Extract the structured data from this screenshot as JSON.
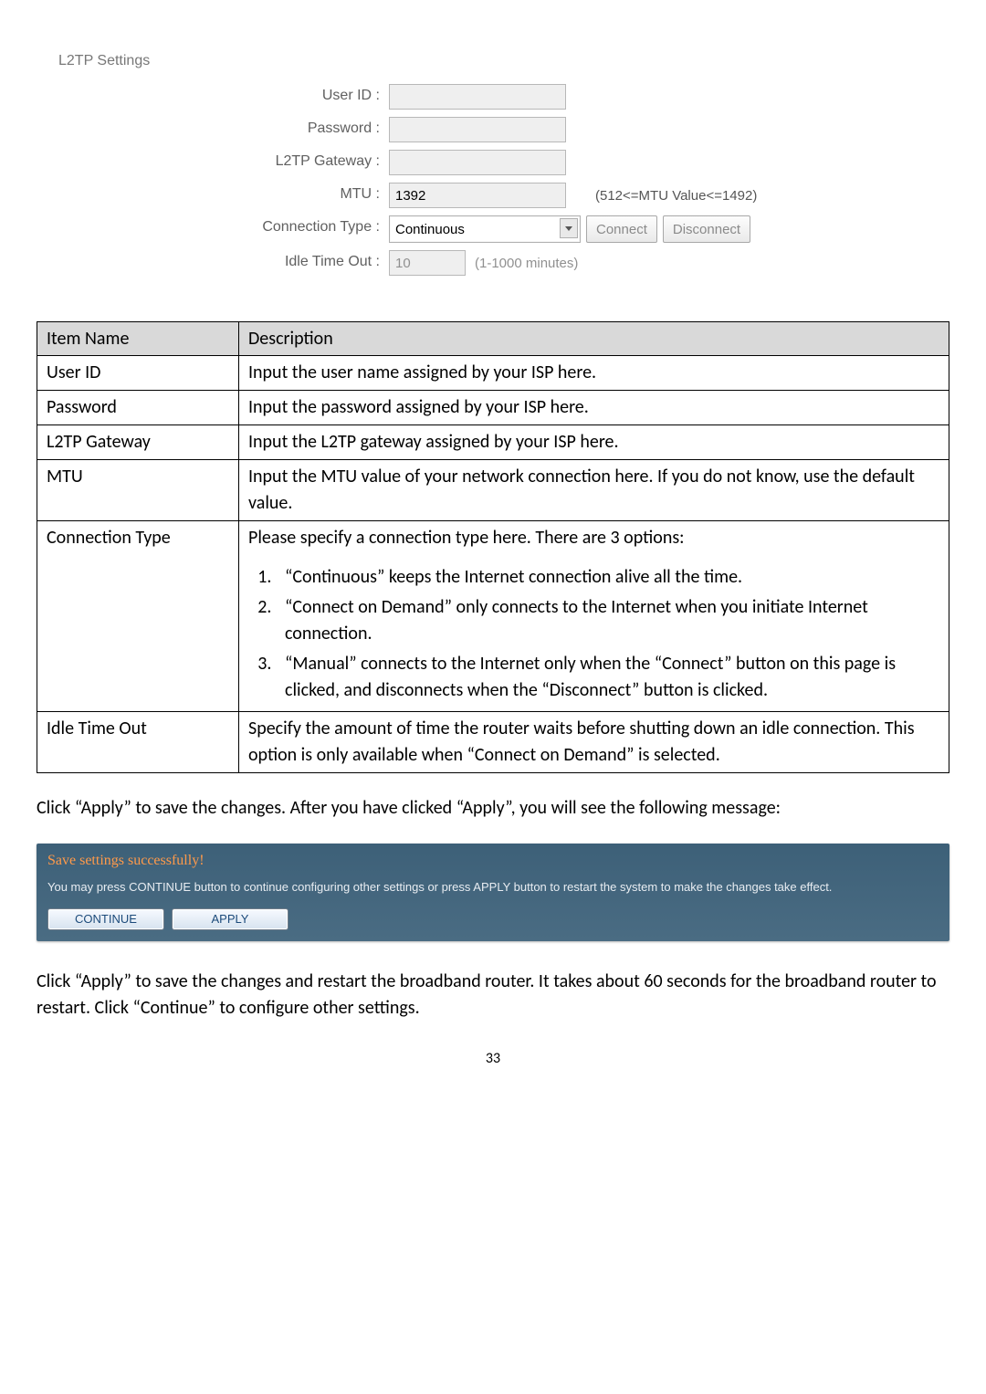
{
  "l2tp": {
    "section_title": "L2TP Settings",
    "labels": {
      "user_id": "User ID :",
      "password": "Password :",
      "gateway": "L2TP Gateway :",
      "mtu": "MTU :",
      "conn_type": "Connection Type :",
      "idle": "Idle Time Out :"
    },
    "values": {
      "user_id": "",
      "password": "",
      "gateway": "",
      "mtu": "1392",
      "conn_type": "Continuous",
      "idle": "10"
    },
    "hints": {
      "mtu": "(512<=MTU Value<=1492)",
      "idle": "(1-1000 minutes)"
    },
    "buttons": {
      "connect": "Connect",
      "disconnect": "Disconnect"
    }
  },
  "table": {
    "headers": {
      "name": "Item Name",
      "desc": "Description"
    },
    "rows": {
      "user_id": {
        "name": "User ID",
        "desc": "Input the user name assigned by your ISP here."
      },
      "password": {
        "name": "Password",
        "desc": "Input the password assigned by your ISP here."
      },
      "gateway": {
        "name": "L2TP Gateway",
        "desc": "Input the L2TP gateway assigned by your ISP here."
      },
      "mtu": {
        "name": "MTU",
        "desc": "Input the MTU value of your network connection here. If you do not know, use the default value."
      },
      "conn": {
        "name": "Connection Type",
        "lead": "Please specify a connection type here. There are 3 options:",
        "opt1": "“Continuous” keeps the Internet connection alive all the time.",
        "opt2": "“Connect on Demand” only connects to the Internet when you initiate Internet connection.",
        "opt3": "“Manual” connects to the Internet only when the “Connect” button on this page is clicked, and disconnects when the “Disconnect” button is clicked."
      },
      "idle": {
        "name": "Idle Time Out",
        "desc": "Specify the amount of time the router waits before shutting down an idle connection. This option is only available when “Connect on Demand” is selected."
      }
    }
  },
  "paragraphs": {
    "p1": "Click “Apply” to save the changes. After you have clicked “Apply”, you will see the following message:",
    "p2": "Click “Apply” to save the changes and restart the broadband router. It takes about 60 seconds for the broadband router to restart. Click “Continue” to configure other settings."
  },
  "save_panel": {
    "title": "Save settings successfully!",
    "msg": "You may press CONTINUE button to continue configuring other settings or press APPLY button to restart the system to make the changes take effect.",
    "continue": "CONTINUE",
    "apply": "APPLY"
  },
  "page_number": "33"
}
